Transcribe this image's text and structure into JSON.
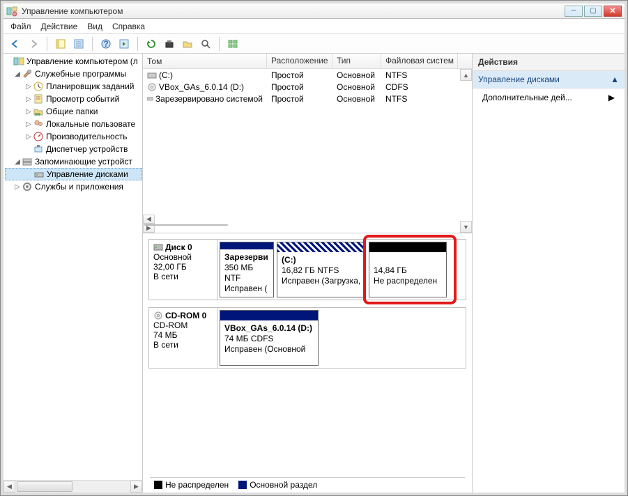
{
  "window": {
    "title": "Управление компьютером"
  },
  "menu": {
    "file": "Файл",
    "action": "Действие",
    "view": "Вид",
    "help": "Справка"
  },
  "tree": {
    "root": "Управление компьютером (л",
    "n1": "Служебные программы",
    "n1a": "Планировщик заданий",
    "n1b": "Просмотр событий",
    "n1c": "Общие папки",
    "n1d": "Локальные пользовате",
    "n1e": "Производительность",
    "n1f": "Диспетчер устройств",
    "n2": "Запоминающие устройст",
    "n2a": "Управление дисками",
    "n3": "Службы и приложения"
  },
  "volumes": {
    "headers": {
      "vol": "Том",
      "layout": "Расположение",
      "type": "Тип",
      "fs": "Файловая систем"
    },
    "rows": [
      {
        "vol": "(C:)",
        "layout": "Простой",
        "type": "Основной",
        "fs": "NTFS"
      },
      {
        "vol": "VBox_GAs_6.0.14 (D:)",
        "layout": "Простой",
        "type": "Основной",
        "fs": "CDFS"
      },
      {
        "vol": "Зарезервировано системой",
        "layout": "Простой",
        "type": "Основной",
        "fs": "NTFS"
      }
    ]
  },
  "disks": {
    "d0": {
      "name": "Диск 0",
      "kind": "Основной",
      "size": "32,00 ГБ",
      "status": "В сети",
      "p1": {
        "name": "Зарезерви",
        "size": "350 МБ NTF",
        "status": "Исправен ("
      },
      "p2": {
        "name": "(C:)",
        "size": "16,82 ГБ NTFS",
        "status": "Исправен (Загрузка,"
      },
      "p3": {
        "size": "14,84 ГБ",
        "status": "Не распределен"
      }
    },
    "cd0": {
      "name": "CD-ROM 0",
      "kind": "CD-ROM",
      "size": "74 МБ",
      "status": "В сети",
      "p1": {
        "name": "VBox_GAs_6.0.14  (D:)",
        "size": "74 МБ CDFS",
        "status": "Исправен (Основной"
      }
    }
  },
  "legend": {
    "unalloc": "Не распределен",
    "primary": "Основной раздел"
  },
  "actions": {
    "title": "Действия",
    "sub": "Управление дисками",
    "more": "Дополнительные дей..."
  }
}
